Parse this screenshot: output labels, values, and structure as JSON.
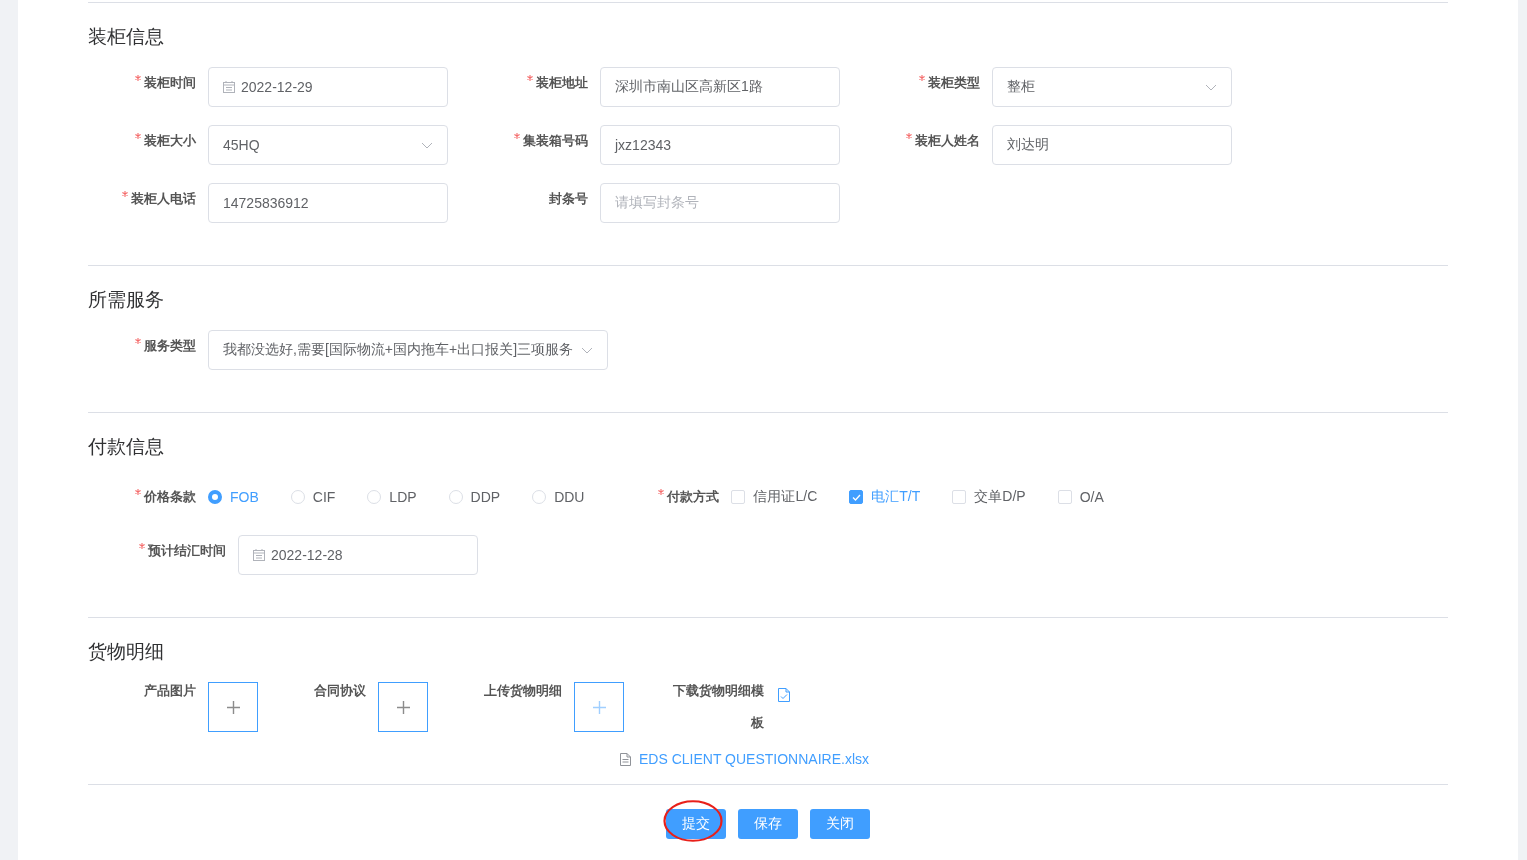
{
  "container_info": {
    "title": "装柜信息",
    "fields": [
      {
        "label": "装柜时间",
        "required": true,
        "kind": "date",
        "value": "2022-12-29"
      },
      {
        "label": "装柜地址",
        "required": true,
        "kind": "text",
        "value": "深圳市南山区高新区1路"
      },
      {
        "label": "装柜类型",
        "required": true,
        "kind": "select",
        "value": "整柜"
      },
      {
        "label": "装柜大小",
        "required": true,
        "kind": "select",
        "value": "45HQ"
      },
      {
        "label": "集装箱号码",
        "required": true,
        "kind": "text",
        "value": "jxz12343"
      },
      {
        "label": "装柜人姓名",
        "required": true,
        "kind": "text",
        "value": "刘达明"
      },
      {
        "label": "装柜人电话",
        "required": true,
        "kind": "text",
        "value": "14725836912"
      },
      {
        "label": "封条号",
        "required": false,
        "kind": "text",
        "placeholder": "请填写封条号"
      }
    ]
  },
  "service": {
    "title": "所需服务",
    "fields": [
      {
        "label": "服务类型",
        "required": true,
        "kind": "select",
        "value": "我都没选好,需要[国际物流+国内拖车+出口报关]三项服务"
      }
    ]
  },
  "payment": {
    "title": "付款信息",
    "price_terms": {
      "label": "价格条款",
      "required": true,
      "options": [
        {
          "label": "FOB",
          "selected": true
        },
        {
          "label": "CIF",
          "selected": false
        },
        {
          "label": "LDP",
          "selected": false
        },
        {
          "label": "DDP",
          "selected": false
        },
        {
          "label": "DDU",
          "selected": false
        }
      ]
    },
    "payment_method": {
      "label": "付款方式",
      "required": true,
      "options": [
        {
          "label": "信用证L/C",
          "checked": false
        },
        {
          "label": "电汇T/T",
          "checked": true
        },
        {
          "label": "交单D/P",
          "checked": false
        },
        {
          "label": "O/A",
          "checked": false
        }
      ]
    },
    "settlement_date": {
      "label": "预计结汇时间",
      "required": true,
      "kind": "date",
      "value": "2022-12-28"
    }
  },
  "goods": {
    "title": "货物明细",
    "uploads": [
      {
        "label": "产品图片",
        "active": false
      },
      {
        "label": "合同协议",
        "active": false
      },
      {
        "label": "上传货物明细",
        "active": true
      }
    ],
    "template": {
      "label": "下载货物明细模板"
    },
    "file": {
      "name": "EDS CLIENT QUESTIONNAIRE.xlsx"
    }
  },
  "buttons": [
    {
      "label": "提交",
      "annotated": true
    },
    {
      "label": "保存",
      "annotated": false
    },
    {
      "label": "关闭",
      "annotated": false
    }
  ]
}
